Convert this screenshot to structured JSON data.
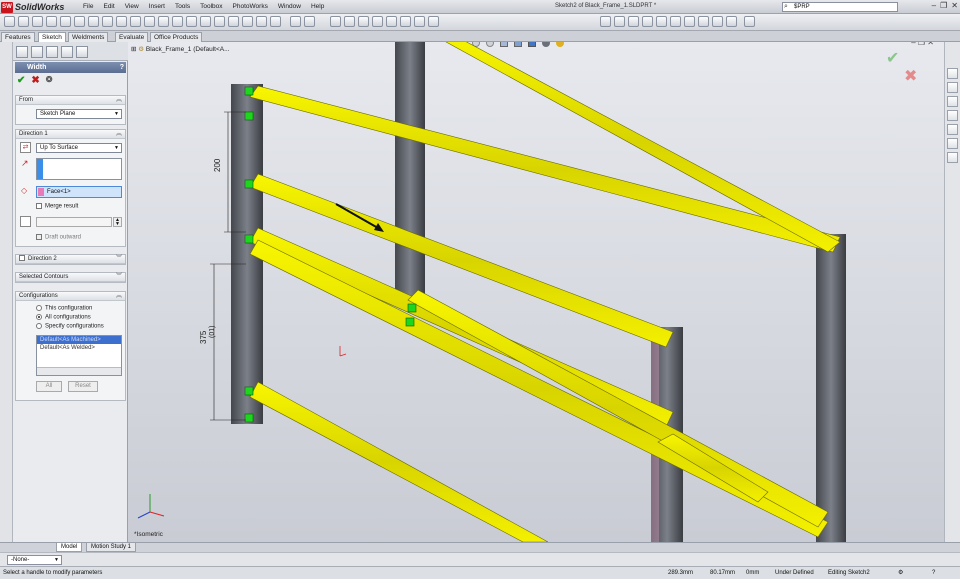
{
  "app": {
    "brand": "SolidWorks",
    "badge": "SW",
    "doc_title": "Sketch2 of Black_Frame_1.SLDPRT *",
    "search_value": "$PRP",
    "search_icon": "magnifier-icon"
  },
  "menus": [
    "File",
    "Edit",
    "View",
    "Insert",
    "Tools",
    "Toolbox",
    "PhotoWorks",
    "Window",
    "Help"
  ],
  "tabs": [
    "Features",
    "Sketch",
    "Weldments",
    "Evaluate",
    "Office Products"
  ],
  "active_tab": "Sketch",
  "tree": {
    "node": "Black_Frame_1  (Default<A..."
  },
  "property_manager": {
    "title": "Width",
    "help": "?",
    "ok": "✔",
    "cancel": "✖",
    "from": {
      "header": "From",
      "value": "Sketch Plane"
    },
    "direction1": {
      "header": "Direction 1",
      "end_condition": "Up To Surface",
      "face": "Face<1>",
      "merge_result": "Merge result",
      "draft_outward": "Draft outward"
    },
    "direction2": {
      "header": "Direction 2"
    },
    "selected_contours": {
      "header": "Selected Contours"
    },
    "configurations": {
      "header": "Configurations",
      "options": [
        "This configuration",
        "All configurations",
        "Specify configurations"
      ],
      "selected": "All configurations",
      "list": [
        "Default<As Machined>",
        "Default<As Welded>"
      ],
      "btn_all": "All",
      "btn_reset": "Reset"
    }
  },
  "viewport": {
    "view_label": "*Isometric",
    "dim_upper": "200",
    "dim_lower": "375",
    "dim_lower_sub": "(01)"
  },
  "bottom_tabs": [
    "Model",
    "Motion Study 1"
  ],
  "config_select": "-None-",
  "status": {
    "hint": "Select a handle to modify parameters",
    "x": "289.3mm",
    "y": "80.17mm",
    "z": "0mm",
    "state": "Under Defined",
    "editing": "Editing Sketch2"
  },
  "colors": {
    "profile": "#f2f000",
    "profile_edge": "#6a6a00",
    "post": "#5c6068",
    "accent": "#5a6d92"
  }
}
